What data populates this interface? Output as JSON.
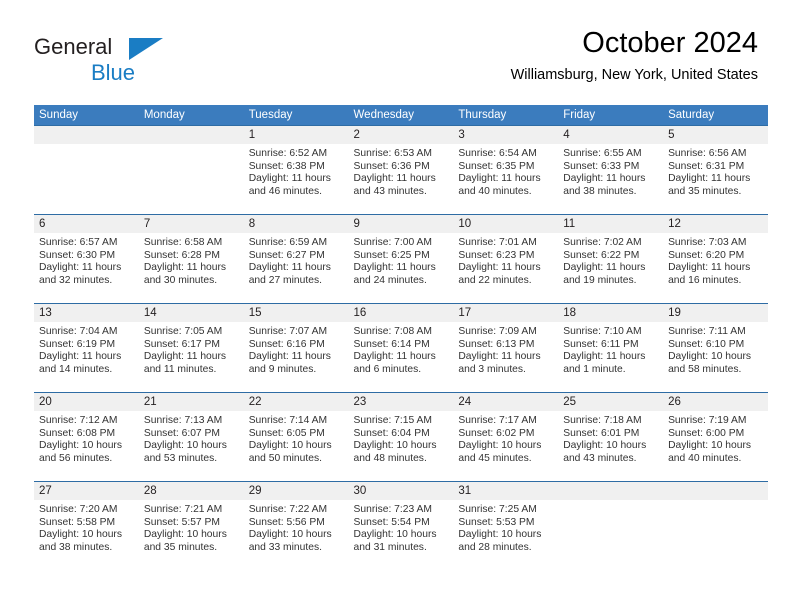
{
  "brand": {
    "line1": "General",
    "line2": "Blue",
    "triangle_color": "#1a7dc4"
  },
  "header": {
    "title": "October 2024",
    "subtitle": "Williamsburg, New York, United States"
  },
  "theme": {
    "header_blue": "#3b7cbe",
    "rule_blue": "#2e6ca4",
    "daynum_band": "#f0f0f0",
    "body_text": "#333333"
  },
  "labels": {
    "sunrise_prefix": "Sunrise: ",
    "sunset_prefix": "Sunset: ",
    "daylight_prefix": "Daylight: "
  },
  "weekdays": [
    "Sunday",
    "Monday",
    "Tuesday",
    "Wednesday",
    "Thursday",
    "Friday",
    "Saturday"
  ],
  "weeks": [
    [
      {
        "day": ""
      },
      {
        "day": ""
      },
      {
        "day": "1",
        "sunrise": "Sunrise: 6:52 AM",
        "sunset": "Sunset: 6:38 PM",
        "daylight": "Daylight: 11 hours and 46 minutes."
      },
      {
        "day": "2",
        "sunrise": "Sunrise: 6:53 AM",
        "sunset": "Sunset: 6:36 PM",
        "daylight": "Daylight: 11 hours and 43 minutes."
      },
      {
        "day": "3",
        "sunrise": "Sunrise: 6:54 AM",
        "sunset": "Sunset: 6:35 PM",
        "daylight": "Daylight: 11 hours and 40 minutes."
      },
      {
        "day": "4",
        "sunrise": "Sunrise: 6:55 AM",
        "sunset": "Sunset: 6:33 PM",
        "daylight": "Daylight: 11 hours and 38 minutes."
      },
      {
        "day": "5",
        "sunrise": "Sunrise: 6:56 AM",
        "sunset": "Sunset: 6:31 PM",
        "daylight": "Daylight: 11 hours and 35 minutes."
      }
    ],
    [
      {
        "day": "6",
        "sunrise": "Sunrise: 6:57 AM",
        "sunset": "Sunset: 6:30 PM",
        "daylight": "Daylight: 11 hours and 32 minutes."
      },
      {
        "day": "7",
        "sunrise": "Sunrise: 6:58 AM",
        "sunset": "Sunset: 6:28 PM",
        "daylight": "Daylight: 11 hours and 30 minutes."
      },
      {
        "day": "8",
        "sunrise": "Sunrise: 6:59 AM",
        "sunset": "Sunset: 6:27 PM",
        "daylight": "Daylight: 11 hours and 27 minutes."
      },
      {
        "day": "9",
        "sunrise": "Sunrise: 7:00 AM",
        "sunset": "Sunset: 6:25 PM",
        "daylight": "Daylight: 11 hours and 24 minutes."
      },
      {
        "day": "10",
        "sunrise": "Sunrise: 7:01 AM",
        "sunset": "Sunset: 6:23 PM",
        "daylight": "Daylight: 11 hours and 22 minutes."
      },
      {
        "day": "11",
        "sunrise": "Sunrise: 7:02 AM",
        "sunset": "Sunset: 6:22 PM",
        "daylight": "Daylight: 11 hours and 19 minutes."
      },
      {
        "day": "12",
        "sunrise": "Sunrise: 7:03 AM",
        "sunset": "Sunset: 6:20 PM",
        "daylight": "Daylight: 11 hours and 16 minutes."
      }
    ],
    [
      {
        "day": "13",
        "sunrise": "Sunrise: 7:04 AM",
        "sunset": "Sunset: 6:19 PM",
        "daylight": "Daylight: 11 hours and 14 minutes."
      },
      {
        "day": "14",
        "sunrise": "Sunrise: 7:05 AM",
        "sunset": "Sunset: 6:17 PM",
        "daylight": "Daylight: 11 hours and 11 minutes."
      },
      {
        "day": "15",
        "sunrise": "Sunrise: 7:07 AM",
        "sunset": "Sunset: 6:16 PM",
        "daylight": "Daylight: 11 hours and 9 minutes."
      },
      {
        "day": "16",
        "sunrise": "Sunrise: 7:08 AM",
        "sunset": "Sunset: 6:14 PM",
        "daylight": "Daylight: 11 hours and 6 minutes."
      },
      {
        "day": "17",
        "sunrise": "Sunrise: 7:09 AM",
        "sunset": "Sunset: 6:13 PM",
        "daylight": "Daylight: 11 hours and 3 minutes."
      },
      {
        "day": "18",
        "sunrise": "Sunrise: 7:10 AM",
        "sunset": "Sunset: 6:11 PM",
        "daylight": "Daylight: 11 hours and 1 minute."
      },
      {
        "day": "19",
        "sunrise": "Sunrise: 7:11 AM",
        "sunset": "Sunset: 6:10 PM",
        "daylight": "Daylight: 10 hours and 58 minutes."
      }
    ],
    [
      {
        "day": "20",
        "sunrise": "Sunrise: 7:12 AM",
        "sunset": "Sunset: 6:08 PM",
        "daylight": "Daylight: 10 hours and 56 minutes."
      },
      {
        "day": "21",
        "sunrise": "Sunrise: 7:13 AM",
        "sunset": "Sunset: 6:07 PM",
        "daylight": "Daylight: 10 hours and 53 minutes."
      },
      {
        "day": "22",
        "sunrise": "Sunrise: 7:14 AM",
        "sunset": "Sunset: 6:05 PM",
        "daylight": "Daylight: 10 hours and 50 minutes."
      },
      {
        "day": "23",
        "sunrise": "Sunrise: 7:15 AM",
        "sunset": "Sunset: 6:04 PM",
        "daylight": "Daylight: 10 hours and 48 minutes."
      },
      {
        "day": "24",
        "sunrise": "Sunrise: 7:17 AM",
        "sunset": "Sunset: 6:02 PM",
        "daylight": "Daylight: 10 hours and 45 minutes."
      },
      {
        "day": "25",
        "sunrise": "Sunrise: 7:18 AM",
        "sunset": "Sunset: 6:01 PM",
        "daylight": "Daylight: 10 hours and 43 minutes."
      },
      {
        "day": "26",
        "sunrise": "Sunrise: 7:19 AM",
        "sunset": "Sunset: 6:00 PM",
        "daylight": "Daylight: 10 hours and 40 minutes."
      }
    ],
    [
      {
        "day": "27",
        "sunrise": "Sunrise: 7:20 AM",
        "sunset": "Sunset: 5:58 PM",
        "daylight": "Daylight: 10 hours and 38 minutes."
      },
      {
        "day": "28",
        "sunrise": "Sunrise: 7:21 AM",
        "sunset": "Sunset: 5:57 PM",
        "daylight": "Daylight: 10 hours and 35 minutes."
      },
      {
        "day": "29",
        "sunrise": "Sunrise: 7:22 AM",
        "sunset": "Sunset: 5:56 PM",
        "daylight": "Daylight: 10 hours and 33 minutes."
      },
      {
        "day": "30",
        "sunrise": "Sunrise: 7:23 AM",
        "sunset": "Sunset: 5:54 PM",
        "daylight": "Daylight: 10 hours and 31 minutes."
      },
      {
        "day": "31",
        "sunrise": "Sunrise: 7:25 AM",
        "sunset": "Sunset: 5:53 PM",
        "daylight": "Daylight: 10 hours and 28 minutes."
      },
      {
        "day": ""
      },
      {
        "day": ""
      }
    ]
  ]
}
